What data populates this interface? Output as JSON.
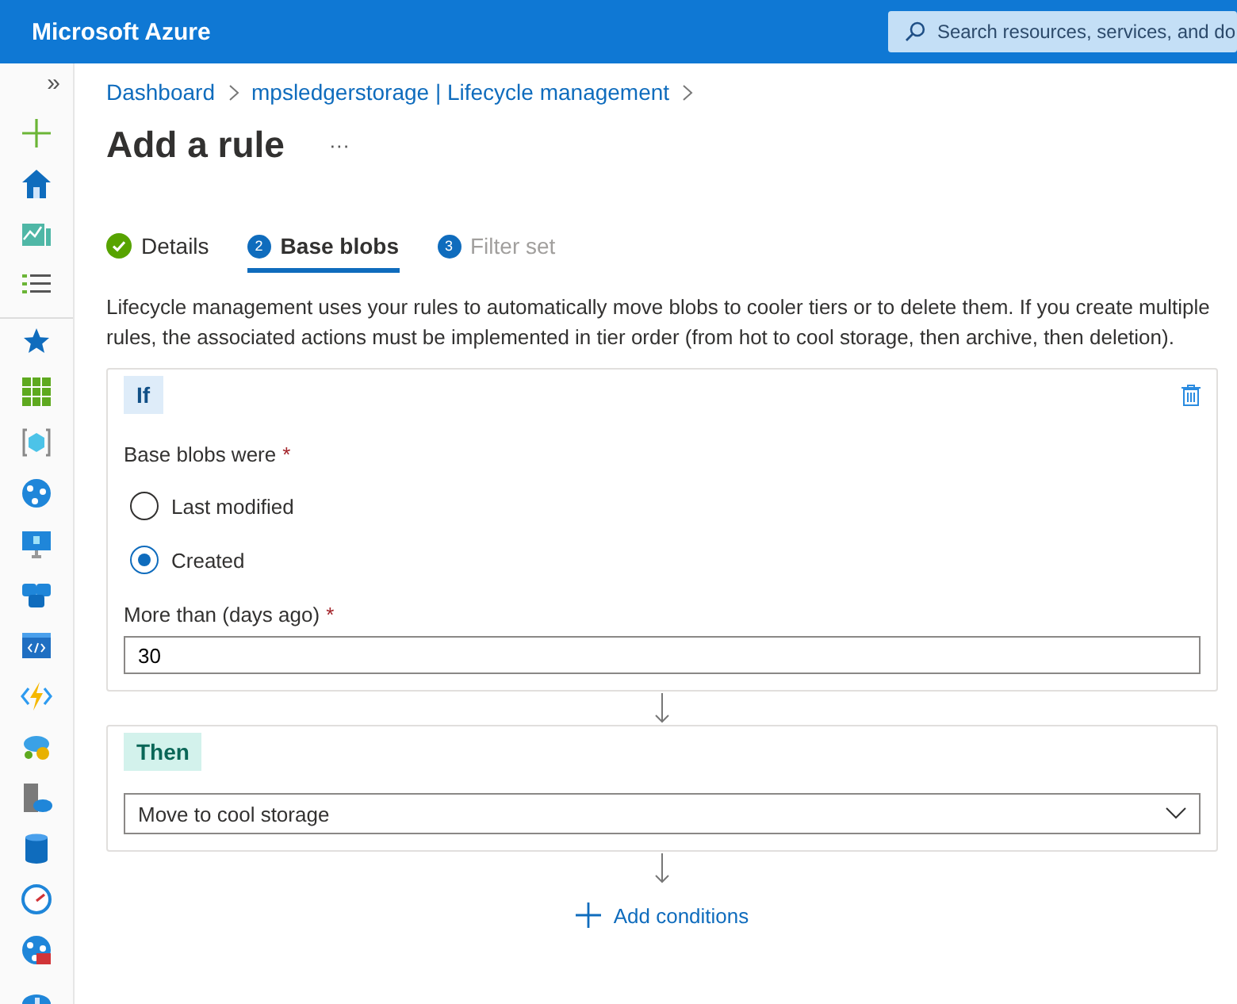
{
  "header": {
    "title": "Microsoft Azure",
    "search": {
      "placeholder": "Search resources, services, and do"
    }
  },
  "sidebar": {
    "expand_glyph": "»"
  },
  "breadcrumb": [
    "Dashboard",
    "mpsledgerstorage | Lifecycle management"
  ],
  "page": {
    "title": "Add a rule",
    "more": "···"
  },
  "steps": [
    {
      "kind": "done",
      "label": "Details",
      "selected": false,
      "disabled": false
    },
    {
      "kind": "number",
      "number": "2",
      "label": "Base blobs",
      "selected": true,
      "disabled": false
    },
    {
      "kind": "number",
      "number": "3",
      "label": "Filter set",
      "selected": false,
      "disabled": true
    }
  ],
  "description": "Lifecycle management uses your rules to automatically move blobs to cooler tiers or to delete them. If you create multiple rules, the associated actions must be implemented in tier order (from hot to cool storage, then archive, then deletion).",
  "if_block": {
    "badge": "If",
    "radio_label": "Base blobs were",
    "required_mark": "*",
    "options": [
      {
        "label": "Last modified",
        "selected": false
      },
      {
        "label": "Created",
        "selected": true
      }
    ],
    "days_label": "More than (days ago)",
    "days_value": "30"
  },
  "then_block": {
    "badge": "Then",
    "action": "Move to cool storage"
  },
  "add_conditions": "Add conditions"
}
